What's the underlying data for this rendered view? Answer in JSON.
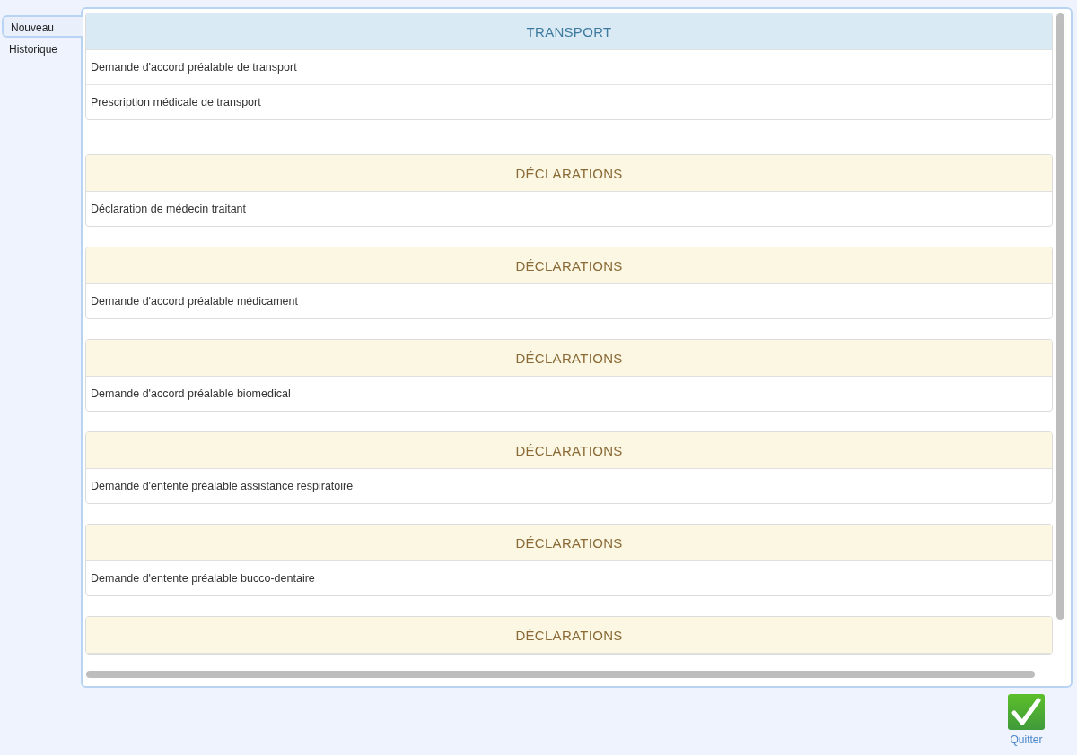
{
  "tabs": [
    {
      "label": "Nouveau",
      "selected": true
    },
    {
      "label": "Historique",
      "selected": false
    }
  ],
  "sections": [
    {
      "kind": "transport",
      "title": "TRANSPORT",
      "items": [
        "Demande d'accord préalable de transport",
        "Prescription médicale de transport"
      ]
    },
    {
      "kind": "declarations",
      "title": "DÉCLARATIONS",
      "items": [
        "Déclaration de médecin traitant"
      ]
    },
    {
      "kind": "declarations",
      "title": "DÉCLARATIONS",
      "items": [
        "Demande d'accord préalable médicament"
      ]
    },
    {
      "kind": "declarations",
      "title": "DÉCLARATIONS",
      "items": [
        "Demande d'accord préalable biomedical"
      ]
    },
    {
      "kind": "declarations",
      "title": "DÉCLARATIONS",
      "items": [
        "Demande d'entente préalable assistance respiratoire"
      ]
    },
    {
      "kind": "declarations",
      "title": "DÉCLARATIONS",
      "items": [
        "Demande d'entente préalable bucco-dentaire"
      ]
    },
    {
      "kind": "declarations",
      "title": "DÉCLARATIONS"
    }
  ],
  "quit_button": {
    "label": "Quitter"
  }
}
